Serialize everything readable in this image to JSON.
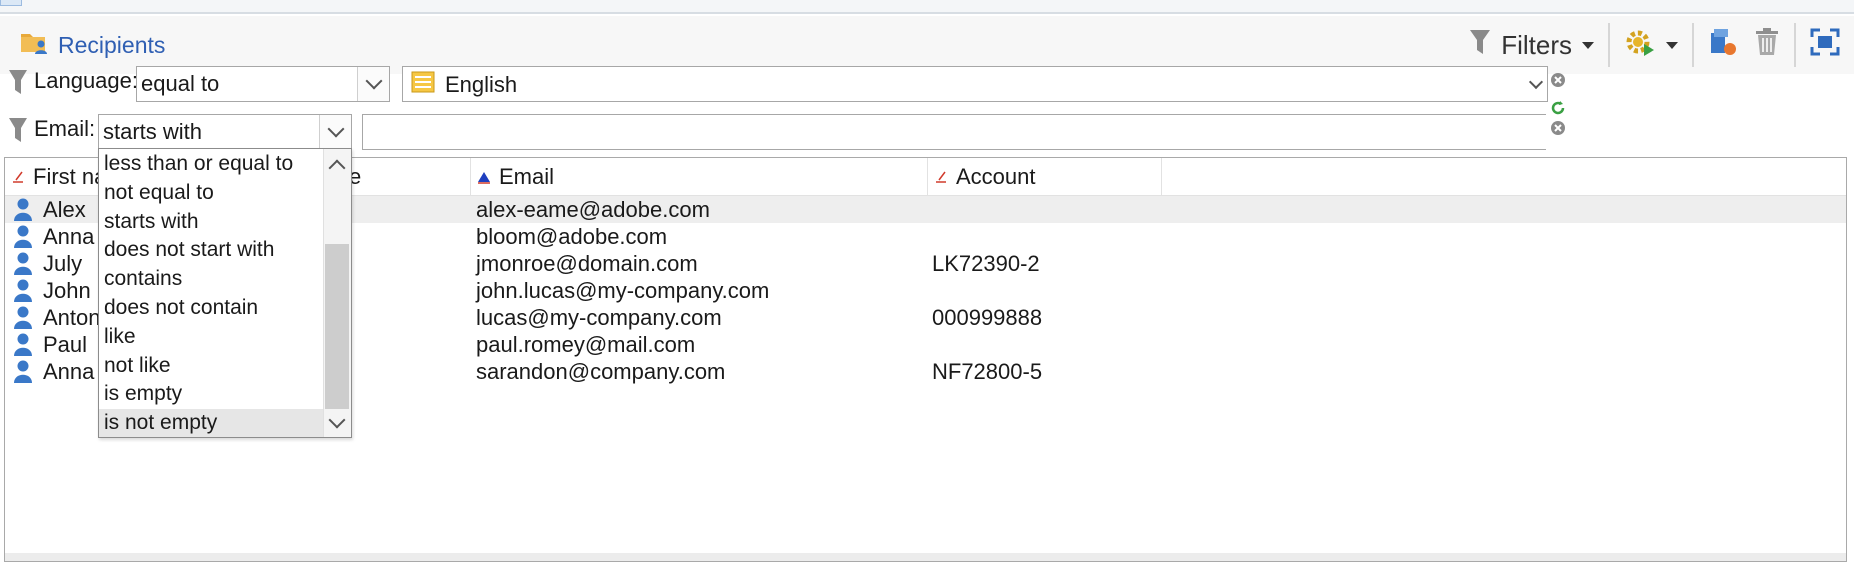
{
  "window": {
    "title": "Recipients"
  },
  "toolbar": {
    "filters_label": "Filters",
    "icons": [
      "folder-user-icon",
      "funnel-icon",
      "gear-play-icon",
      "import-icon",
      "trash-icon",
      "maximize-icon"
    ]
  },
  "filters": [
    {
      "label": "Language:",
      "operator": "equal to",
      "value": "English",
      "value_icon": "list-icon"
    },
    {
      "label": "Email:",
      "operator": "starts with",
      "value": ""
    }
  ],
  "operator_dropdown": {
    "options": [
      "less than or equal to",
      "not equal to",
      "starts with",
      "does not start with",
      "contains",
      "does not contain",
      "like",
      "not like",
      "is empty",
      "is not empty"
    ],
    "highlighted": "is not empty"
  },
  "grid": {
    "columns": [
      {
        "label": "First nar",
        "sort": "none"
      },
      {
        "label": "e",
        "sort": "none"
      },
      {
        "label": "Email",
        "sort": "ascending"
      },
      {
        "label": "Account",
        "sort": "none"
      }
    ],
    "rows": [
      {
        "first_name": "Alex",
        "email": "alex-eame@adobe.com",
        "account": ""
      },
      {
        "first_name": "Anna",
        "email": "bloom@adobe.com",
        "account": ""
      },
      {
        "first_name": "July",
        "email": "jmonroe@domain.com",
        "account": "LK72390-2"
      },
      {
        "first_name": "John",
        "email": "john.lucas@my-company.com",
        "account": ""
      },
      {
        "first_name": "Anton",
        "email": "lucas@my-company.com",
        "account": "000999888"
      },
      {
        "first_name": "Paul",
        "email": "paul.romey@mail.com",
        "account": ""
      },
      {
        "first_name": "Anna",
        "email": "sarandon@company.com",
        "account": "NF72800-5"
      }
    ]
  },
  "colors": {
    "accent": "#2f5fb3",
    "person_icon": "#3a78c8",
    "folder": "#e8a93a",
    "sort_asc": "#1f3fbf",
    "sort_none": "#d13a2b"
  }
}
